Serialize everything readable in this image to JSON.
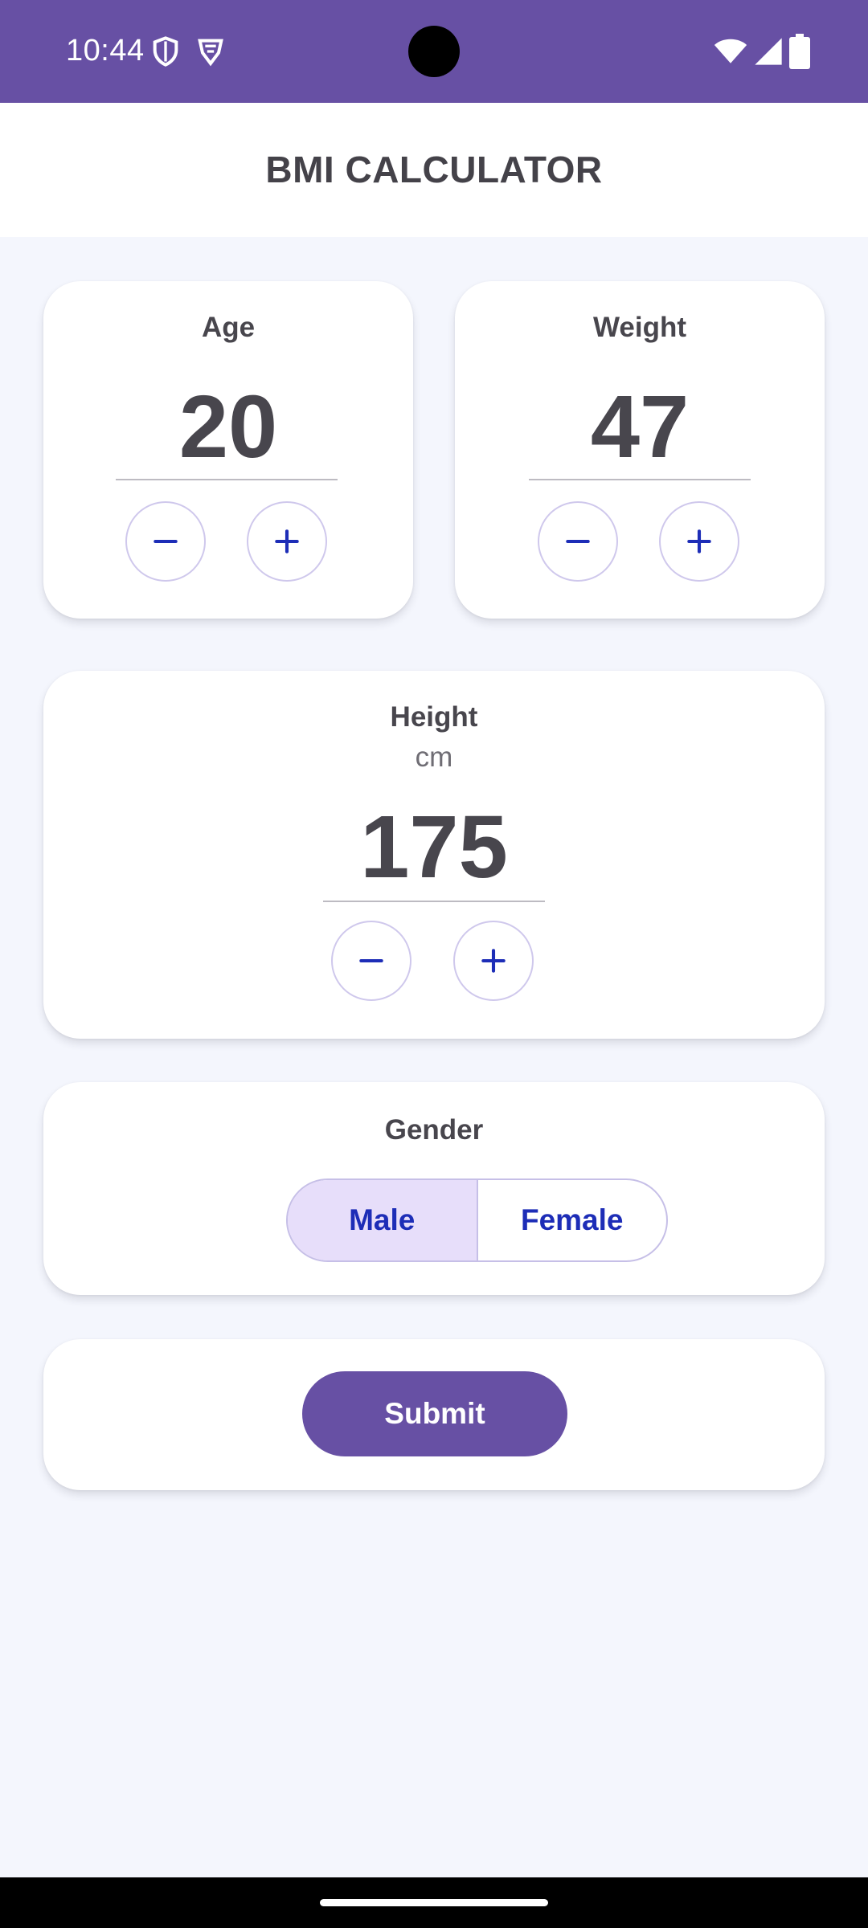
{
  "status_bar": {
    "time": "10:44",
    "left_icons": [
      "shield-icon",
      "vpn-key-icon"
    ],
    "right_icons": [
      "wifi-icon",
      "cell-signal-icon",
      "battery-icon"
    ]
  },
  "app_bar": {
    "title": "BMI CALCULATOR"
  },
  "age": {
    "label": "Age",
    "value": "20"
  },
  "weight": {
    "label": "Weight",
    "value": "47"
  },
  "height": {
    "label": "Height",
    "unit": "cm",
    "value": "175"
  },
  "gender": {
    "label": "Gender",
    "options": [
      "Male",
      "Female"
    ],
    "selected": "Male"
  },
  "submit": {
    "label": "Submit"
  },
  "colors": {
    "primary": "#6750a4",
    "selected_segment": "#e7defa",
    "segment_text": "#1d2db7",
    "background": "#f4f6fd"
  }
}
